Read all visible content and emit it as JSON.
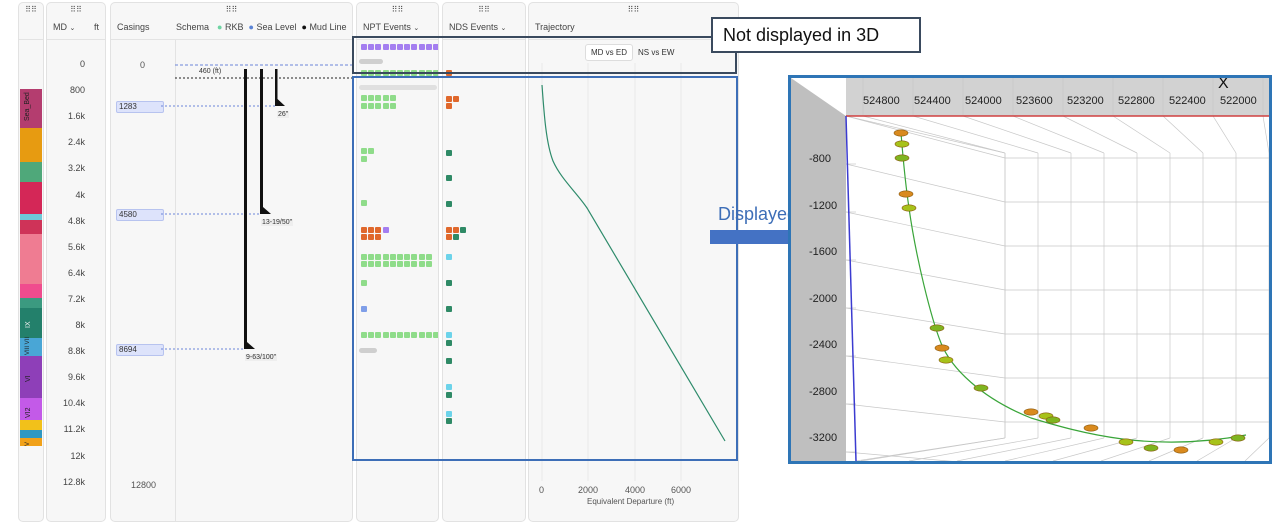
{
  "app": {
    "panels": {
      "md": {
        "title": "MD",
        "unit": "ft"
      },
      "casings": {
        "title": "Casings"
      },
      "schema": {
        "title": "Schema",
        "legend": [
          "RKB",
          "Sea Level",
          "Mud Line"
        ]
      },
      "npt": {
        "title": "NPT Events"
      },
      "nds": {
        "title": "NDS Events"
      },
      "trajectory": {
        "title": "Trajectory",
        "buttons": [
          "MD vs ED",
          "NS vs EW"
        ],
        "x_label": "Equivalent Departure (ft)",
        "x_ticks": [
          "0",
          "2000",
          "4000",
          "6000"
        ]
      }
    },
    "md_ticks": [
      "0",
      "800",
      "1.6k",
      "2.4k",
      "3.2k",
      "4k",
      "4.8k",
      "5.6k",
      "6.4k",
      "7.2k",
      "8k",
      "8.8k",
      "9.6k",
      "10.4k",
      "11.2k",
      "12k",
      "12.8k"
    ],
    "formations": [
      "Sea_Bed",
      "IX",
      "VIII VII",
      "VI",
      "VI2",
      "VI1",
      "V"
    ],
    "casings": {
      "labels": [
        "1283",
        "4580",
        "8694"
      ],
      "top": "0",
      "bottom": "12800"
    },
    "schema": {
      "depth_label": "460 (ft)",
      "shoes": [
        "26\"",
        "13-19/50\"",
        "9-63/100\""
      ]
    }
  },
  "annotations": {
    "not_displayed": "Not displayed in 3D",
    "displayed": "Displayed in 3D"
  },
  "view3d": {
    "x_axis_label": "X",
    "x_ticks": [
      "524800",
      "524400",
      "524000",
      "523600",
      "523200",
      "522800",
      "522400",
      "522000"
    ],
    "z_ticks": [
      "-800",
      "-1200",
      "-1600",
      "-2000",
      "-2400",
      "-2800",
      "-3200"
    ]
  },
  "colors": {
    "npt_purple": "#a47ef0",
    "npt_green": "#8fdc8a",
    "npt_orange": "#e0682c",
    "nds_orange": "#e0682c",
    "nds_teal": "#2f8a66",
    "nds_cyan": "#6cd3ea",
    "blue_box": "#3d6eb7",
    "trajectory": "#2e8b6b"
  }
}
